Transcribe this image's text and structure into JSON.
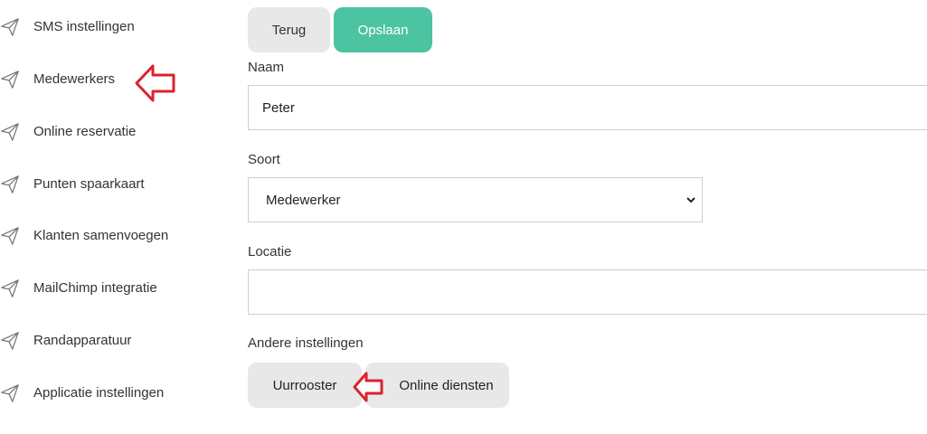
{
  "sidebar": {
    "items": [
      {
        "label": "SMS instellingen",
        "icon": "send-icon"
      },
      {
        "label": "Medewerkers",
        "icon": "send-icon"
      },
      {
        "label": "Online reservatie",
        "icon": "send-icon"
      },
      {
        "label": "Punten spaarkaart",
        "icon": "send-icon"
      },
      {
        "label": "Klanten samenvoegen",
        "icon": "send-icon"
      },
      {
        "label": "MailChimp integratie",
        "icon": "send-icon"
      },
      {
        "label": "Randapparatuur",
        "icon": "send-icon"
      },
      {
        "label": "Applicatie instellingen",
        "icon": "send-icon"
      }
    ]
  },
  "toolbar": {
    "back_label": "Terug",
    "save_label": "Opslaan"
  },
  "form": {
    "name_label": "Naam",
    "name_value": "Peter",
    "type_label": "Soort",
    "type_value": "Medewerker",
    "location_label": "Locatie",
    "location_value": "",
    "other_settings_label": "Andere instellingen"
  },
  "settings_tabs": {
    "schedule_label": "Uurrooster",
    "online_services_label": "Online diensten"
  },
  "footer_partial": "",
  "colors": {
    "accent": "#4cc3a1",
    "annotation_arrow": "#d9232d"
  }
}
